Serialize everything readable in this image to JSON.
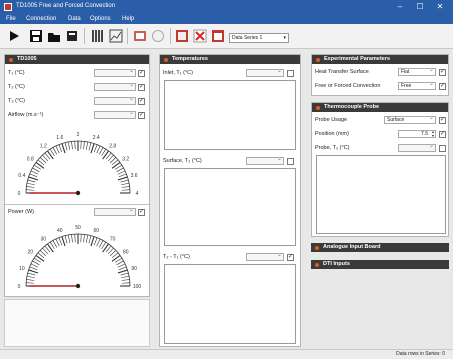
{
  "window": {
    "title": "TD1005 Free and Forced Convection",
    "minimize": "–",
    "maximize": "☐",
    "close": "✕"
  },
  "menu": [
    "File",
    "Connection",
    "Data",
    "Options",
    "Help"
  ],
  "toolbar": {
    "series_value": "Data Series 1"
  },
  "left_panel": {
    "title": "TD1005",
    "rows": [
      {
        "label": "T₁  (°C)"
      },
      {
        "label": "T₂  (°C)"
      },
      {
        "label": "T₃  (°C)"
      },
      {
        "label": "Airflow  (m.s⁻¹)"
      }
    ],
    "airflow_gauge": {
      "ticks": [
        "0",
        "0.4",
        "0.8",
        "1.2",
        "1.6",
        "2",
        "2.4",
        "2.8",
        "3.2",
        "3.6",
        "4"
      ],
      "needle_value": 0,
      "max": 4
    },
    "power_label": "Power  (W)",
    "power_gauge": {
      "ticks": [
        "0",
        "10",
        "20",
        "30",
        "40",
        "50",
        "60",
        "70",
        "80",
        "90",
        "100"
      ],
      "needle_value": 0,
      "max": 100
    }
  },
  "temperatures_panel": {
    "title": "Temperatures",
    "plots": [
      {
        "label": "Inlet, T₁  (°C)"
      },
      {
        "label": "Surface, T₂  (°C)"
      },
      {
        "label": "T₂ - T₁  (°C)"
      }
    ]
  },
  "experimental_panel": {
    "title": "Experimental Parameters",
    "rows": [
      {
        "label": "Heat Transfer Surface",
        "value": "Flat"
      },
      {
        "label": "Free or Forced Convection",
        "value": "Free"
      }
    ]
  },
  "thermocouple_panel": {
    "title": "Thermocouple Probe",
    "usage_label": "Probe Usage",
    "usage_value": "Surface",
    "position_label": "Position  (mm)",
    "position_value": "7.5",
    "probe_label": "Probe, T₂  (°C)"
  },
  "analogue_panel": {
    "title": "Analogue Input Board"
  },
  "dti_panel": {
    "title": "DTI Inputs"
  },
  "status": {
    "text": "Data rows in Series: 0"
  },
  "colors": {
    "titlebar": "#2b5ea8",
    "panel_header": "#3a3a3a",
    "header_dot": "#e05a1a",
    "needle": "#b22222"
  }
}
